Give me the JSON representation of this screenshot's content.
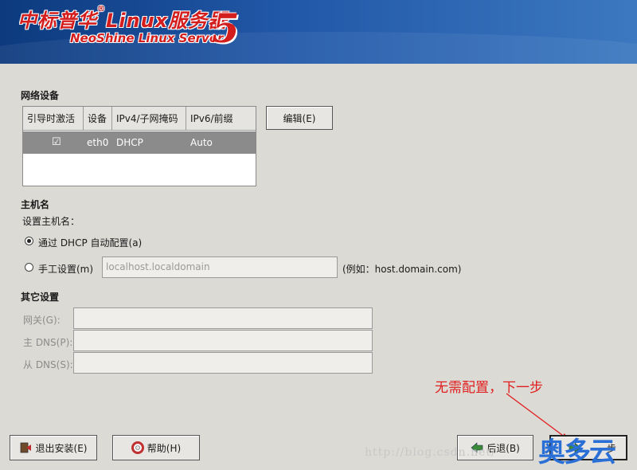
{
  "banner": {
    "logo_cn": "中标普华",
    "logo_linux": "Linux服务器",
    "logo_en": "NeoShine Linux Server",
    "logo_num": "5"
  },
  "network": {
    "title": "网络设备",
    "columns": [
      "引导时激活",
      "设备",
      "IPv4/子网掩码",
      "IPv6/前缀"
    ],
    "rows": [
      {
        "active": "☑",
        "device": "eth0",
        "ipv4": "DHCP",
        "ipv6": "Auto"
      }
    ],
    "edit_button": "编辑(E)"
  },
  "hostname": {
    "title": "主机名",
    "prompt": "设置主机名：",
    "dhcp_option": "通过 DHCP 自动配置(a)",
    "manual_option": "手工设置(m)",
    "manual_placeholder": "localhost.localdomain",
    "example": "(例如：host.domain.com)"
  },
  "other": {
    "title": "其它设置",
    "gateway_label": "网关(G):",
    "primary_dns_label": "主 DNS(P):",
    "secondary_dns_label": "从 DNS(S):"
  },
  "annotation": "无需配置，下一步",
  "footer": {
    "exit_button": "退出安装(E)",
    "help_button": "帮助(H)",
    "back_button": "后退(B)",
    "next_button": "步"
  },
  "watermark": "http://blog.csdn.net/",
  "brand": "奥多云",
  "colors": {
    "banner": "#1f55a5",
    "logo": "#d41e1e",
    "annotation": "#e02020",
    "selected_row": "#8b8b8b"
  }
}
